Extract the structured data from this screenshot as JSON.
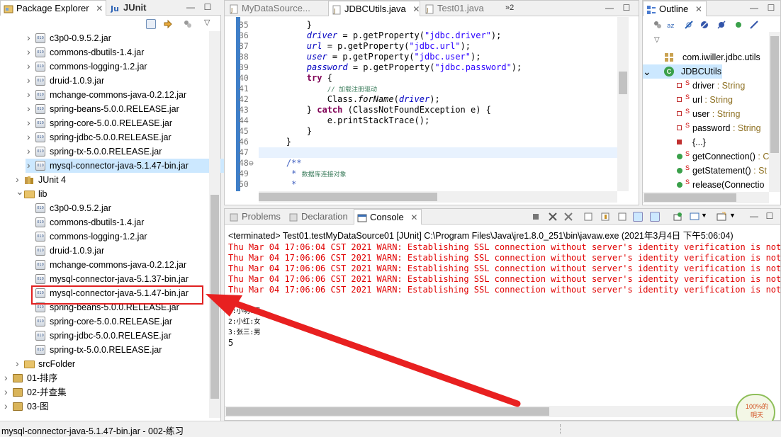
{
  "explorer": {
    "tabs": [
      {
        "label": "Package Explorer",
        "close": "✕"
      },
      {
        "label": "JUnit"
      }
    ],
    "rows": [
      {
        "label": "c3p0-0.9.5.2.jar",
        "kind": "jar",
        "level": 1,
        "twisty": "›"
      },
      {
        "label": "commons-dbutils-1.4.jar",
        "kind": "jar",
        "level": 1,
        "twisty": "›"
      },
      {
        "label": "commons-logging-1.2.jar",
        "kind": "jar",
        "level": 1,
        "twisty": "›"
      },
      {
        "label": "druid-1.0.9.jar",
        "kind": "jar",
        "level": 1,
        "twisty": "›"
      },
      {
        "label": "mchange-commons-java-0.2.12.jar",
        "kind": "jar",
        "level": 1,
        "twisty": "›"
      },
      {
        "label": "spring-beans-5.0.0.RELEASE.jar",
        "kind": "jar",
        "level": 1,
        "twisty": "›"
      },
      {
        "label": "spring-core-5.0.0.RELEASE.jar",
        "kind": "jar",
        "level": 1,
        "twisty": "›"
      },
      {
        "label": "spring-jdbc-5.0.0.RELEASE.jar",
        "kind": "jar",
        "level": 1,
        "twisty": "›"
      },
      {
        "label": "spring-tx-5.0.0.RELEASE.jar",
        "kind": "jar",
        "level": 1,
        "twisty": "›"
      },
      {
        "label": "mysql-connector-java-5.1.47-bin.jar",
        "kind": "jar",
        "level": 1,
        "twisty": "›",
        "selected": true
      },
      {
        "label": "JUnit 4",
        "kind": "lib",
        "level": 0,
        "twisty": "›"
      },
      {
        "label": "lib",
        "kind": "folder",
        "level": 0,
        "twisty": "⌄"
      },
      {
        "label": "c3p0-0.9.5.2.jar",
        "kind": "jar-plain",
        "level": 1
      },
      {
        "label": "commons-dbutils-1.4.jar",
        "kind": "jar-plain",
        "level": 1
      },
      {
        "label": "commons-logging-1.2.jar",
        "kind": "jar-plain",
        "level": 1
      },
      {
        "label": "druid-1.0.9.jar",
        "kind": "jar-plain",
        "level": 1
      },
      {
        "label": "mchange-commons-java-0.2.12.jar",
        "kind": "jar-plain",
        "level": 1
      },
      {
        "label": "mysql-connector-java-5.1.37-bin.jar",
        "kind": "jar-plain",
        "level": 1
      },
      {
        "label": "mysql-connector-java-5.1.47-bin.jar",
        "kind": "jar-plain",
        "level": 1
      },
      {
        "label": "spring-beans-5.0.0.RELEASE.jar",
        "kind": "jar-plain",
        "level": 1
      },
      {
        "label": "spring-core-5.0.0.RELEASE.jar",
        "kind": "jar-plain",
        "level": 1
      },
      {
        "label": "spring-jdbc-5.0.0.RELEASE.jar",
        "kind": "jar-plain",
        "level": 1
      },
      {
        "label": "spring-tx-5.0.0.RELEASE.jar",
        "kind": "jar-plain",
        "level": 1
      },
      {
        "label": "srcFolder",
        "kind": "folder",
        "level": 0,
        "twisty": "›"
      },
      {
        "label": "01-排序",
        "kind": "project",
        "level": -1,
        "twisty": "›"
      },
      {
        "label": "02-并查集",
        "kind": "project",
        "level": -1,
        "twisty": "›"
      },
      {
        "label": "03-图",
        "kind": "project",
        "level": -1,
        "twisty": "›"
      }
    ]
  },
  "editor": {
    "tabs": [
      {
        "label": "MyDataSource..."
      },
      {
        "label": "JDBCUtils.java",
        "close": "✕"
      },
      {
        "label": "Test01.java"
      },
      {
        "label": "»2"
      }
    ],
    "lines": [
      {
        "n": "35",
        "segs": [
          {
            "t": "        }"
          }
        ]
      },
      {
        "n": "36",
        "segs": [
          {
            "t": "        "
          },
          {
            "t": "driver",
            "c": "fld"
          },
          {
            "t": " = p.getProperty("
          },
          {
            "t": "\"jdbc.driver\"",
            "c": "str"
          },
          {
            "t": ");"
          }
        ]
      },
      {
        "n": "37",
        "segs": [
          {
            "t": "        "
          },
          {
            "t": "url",
            "c": "fld"
          },
          {
            "t": " = p.getProperty("
          },
          {
            "t": "\"jdbc.url\"",
            "c": "str"
          },
          {
            "t": ");"
          }
        ]
      },
      {
        "n": "38",
        "segs": [
          {
            "t": "        "
          },
          {
            "t": "user",
            "c": "fld"
          },
          {
            "t": " = p.getProperty("
          },
          {
            "t": "\"jdbc.user\"",
            "c": "str"
          },
          {
            "t": ");"
          }
        ]
      },
      {
        "n": "39",
        "segs": [
          {
            "t": "        "
          },
          {
            "t": "password",
            "c": "fld"
          },
          {
            "t": " = p.getProperty("
          },
          {
            "t": "\"jdbc.password\"",
            "c": "str"
          },
          {
            "t": ");"
          }
        ]
      },
      {
        "n": "40",
        "segs": [
          {
            "t": "        "
          },
          {
            "t": "try",
            "c": "kw"
          },
          {
            "t": " {"
          }
        ]
      },
      {
        "n": "41",
        "segs": [
          {
            "t": "            "
          },
          {
            "t": "// 加载注册驱动",
            "c": "cm"
          }
        ]
      },
      {
        "n": "42",
        "segs": [
          {
            "t": "            Class."
          },
          {
            "t": "forName",
            "c": "it"
          },
          {
            "t": "("
          },
          {
            "t": "driver",
            "c": "fld"
          },
          {
            "t": ");"
          }
        ]
      },
      {
        "n": "43",
        "segs": [
          {
            "t": "        } "
          },
          {
            "t": "catch",
            "c": "kw"
          },
          {
            "t": " (ClassNotFoundException e) {"
          }
        ]
      },
      {
        "n": "44",
        "segs": [
          {
            "t": "            e.printStackTrace();"
          }
        ]
      },
      {
        "n": "45",
        "segs": [
          {
            "t": "        }"
          }
        ]
      },
      {
        "n": "46",
        "segs": [
          {
            "t": "    }"
          }
        ]
      },
      {
        "n": "47",
        "segs": [
          {
            "t": ""
          }
        ],
        "highlight": true
      },
      {
        "n": "48⊖",
        "segs": [
          {
            "t": "    "
          },
          {
            "t": "/**",
            "c": "jd"
          }
        ]
      },
      {
        "n": "49",
        "segs": [
          {
            "t": "     "
          },
          {
            "t": "* ",
            "c": "jd"
          },
          {
            "t": "数据库连接对象",
            "c": "cm"
          }
        ]
      },
      {
        "n": "50",
        "segs": [
          {
            "t": "     "
          },
          {
            "t": "*",
            "c": "jd"
          }
        ]
      }
    ]
  },
  "outline": {
    "tab": {
      "label": "Outline",
      "close": "✕"
    },
    "rows": [
      {
        "label": "com.iwiller.jdbc.utils",
        "kind": "package"
      },
      {
        "label": "JDBCUtils",
        "kind": "class",
        "selected": true
      },
      {
        "label": "driver",
        "type": " : String",
        "kind": "field"
      },
      {
        "label": "url",
        "type": " : String",
        "kind": "field"
      },
      {
        "label": "user",
        "type": " : String",
        "kind": "field"
      },
      {
        "label": "password",
        "type": " : String",
        "kind": "field"
      },
      {
        "label": "{...}",
        "kind": "init"
      },
      {
        "label": "getConnection()",
        "type": " : C",
        "kind": "method"
      },
      {
        "label": "getStatement()",
        "type": " : St",
        "kind": "method"
      },
      {
        "label": "release(Connectio",
        "kind": "method"
      }
    ],
    "static_marker": "S"
  },
  "console": {
    "tabs": [
      {
        "label": "Problems"
      },
      {
        "label": "Declaration"
      },
      {
        "label": "Console",
        "close": "✕"
      }
    ],
    "terminated": "<terminated> Test01.testMyDataSource01 [JUnit] C:\\Program Files\\Java\\jre1.8.0_251\\bin\\javaw.exe (2021年3月4日 下午5:06:04)",
    "lines": [
      {
        "text": "Thu Mar 04 17:06:04 CST 2021 WARN: Establishing SSL connection without server's identity verification is not",
        "warn": true
      },
      {
        "text": "Thu Mar 04 17:06:06 CST 2021 WARN: Establishing SSL connection without server's identity verification is not",
        "warn": true
      },
      {
        "text": "Thu Mar 04 17:06:06 CST 2021 WARN: Establishing SSL connection without server's identity verification is not",
        "warn": true
      },
      {
        "text": "Thu Mar 04 17:06:06 CST 2021 WARN: Establishing SSL connection without server's identity verification is not",
        "warn": true
      },
      {
        "text": "Thu Mar 04 17:06:06 CST 2021 WARN: Establishing SSL connection without server's identity verification is not",
        "warn": true
      },
      {
        "text": "5"
      },
      {
        "text": "1:小明:男",
        "small": true
      },
      {
        "text": "2:小红:女",
        "small": true
      },
      {
        "text": "3:张三:男",
        "small": true
      },
      {
        "text": "5"
      }
    ]
  },
  "status": {
    "text": "mysql-connector-java-5.1.47-bin.jar - 002-练习"
  },
  "badge": {
    "text": "100%的\n明天"
  },
  "colors": {
    "warn": "#e00000",
    "annotation": "#e02020",
    "selection": "#cce8ff",
    "editor_bar": "#3f7fc8"
  }
}
